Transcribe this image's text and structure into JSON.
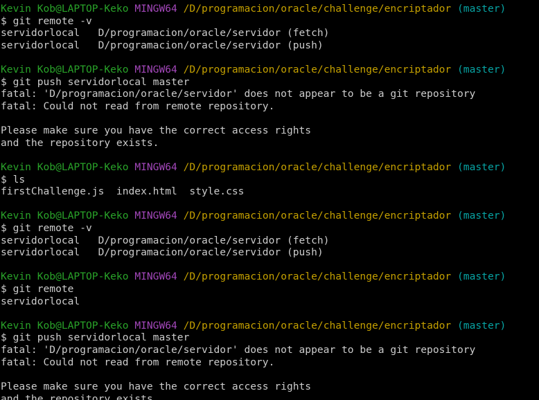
{
  "terminal": {
    "shell_name": "MINGW64",
    "user_host": "Kevin Kob@LAPTOP-Keko",
    "cwd": "/D/programacion/oracle/challenge/encriptador",
    "branch": "(master)",
    "prompt_symbol": "$",
    "colors": {
      "background": "#000000",
      "foreground": "#cccccc",
      "user_host": "#29a329",
      "shell": "#a347ba",
      "path": "#c4a000",
      "branch": "#07a4a4"
    }
  },
  "blocks": [
    {
      "id": "block-1",
      "command": "git remote -v",
      "output": [
        "servidorlocal   D/programacion/oracle/servidor (fetch)",
        "servidorlocal   D/programacion/oracle/servidor (push)",
        ""
      ]
    },
    {
      "id": "block-2",
      "command": "git push servidorlocal master",
      "output": [
        "fatal: 'D/programacion/oracle/servidor' does not appear to be a git repository",
        "fatal: Could not read from remote repository.",
        "",
        "Please make sure you have the correct access rights",
        "and the repository exists.",
        ""
      ]
    },
    {
      "id": "block-3",
      "command": "ls",
      "output": [
        "firstChallenge.js  index.html  style.css",
        ""
      ]
    },
    {
      "id": "block-4",
      "command": "git remote -v",
      "output": [
        "servidorlocal   D/programacion/oracle/servidor (fetch)",
        "servidorlocal   D/programacion/oracle/servidor (push)",
        ""
      ]
    },
    {
      "id": "block-5",
      "command": "git remote",
      "output": [
        "servidorlocal",
        ""
      ]
    },
    {
      "id": "block-6",
      "command": "git push servidorlocal master",
      "output": [
        "fatal: 'D/programacion/oracle/servidor' does not appear to be a git repository",
        "fatal: Could not read from remote repository.",
        "",
        "Please make sure you have the correct access rights",
        "and the repository exists."
      ]
    }
  ]
}
